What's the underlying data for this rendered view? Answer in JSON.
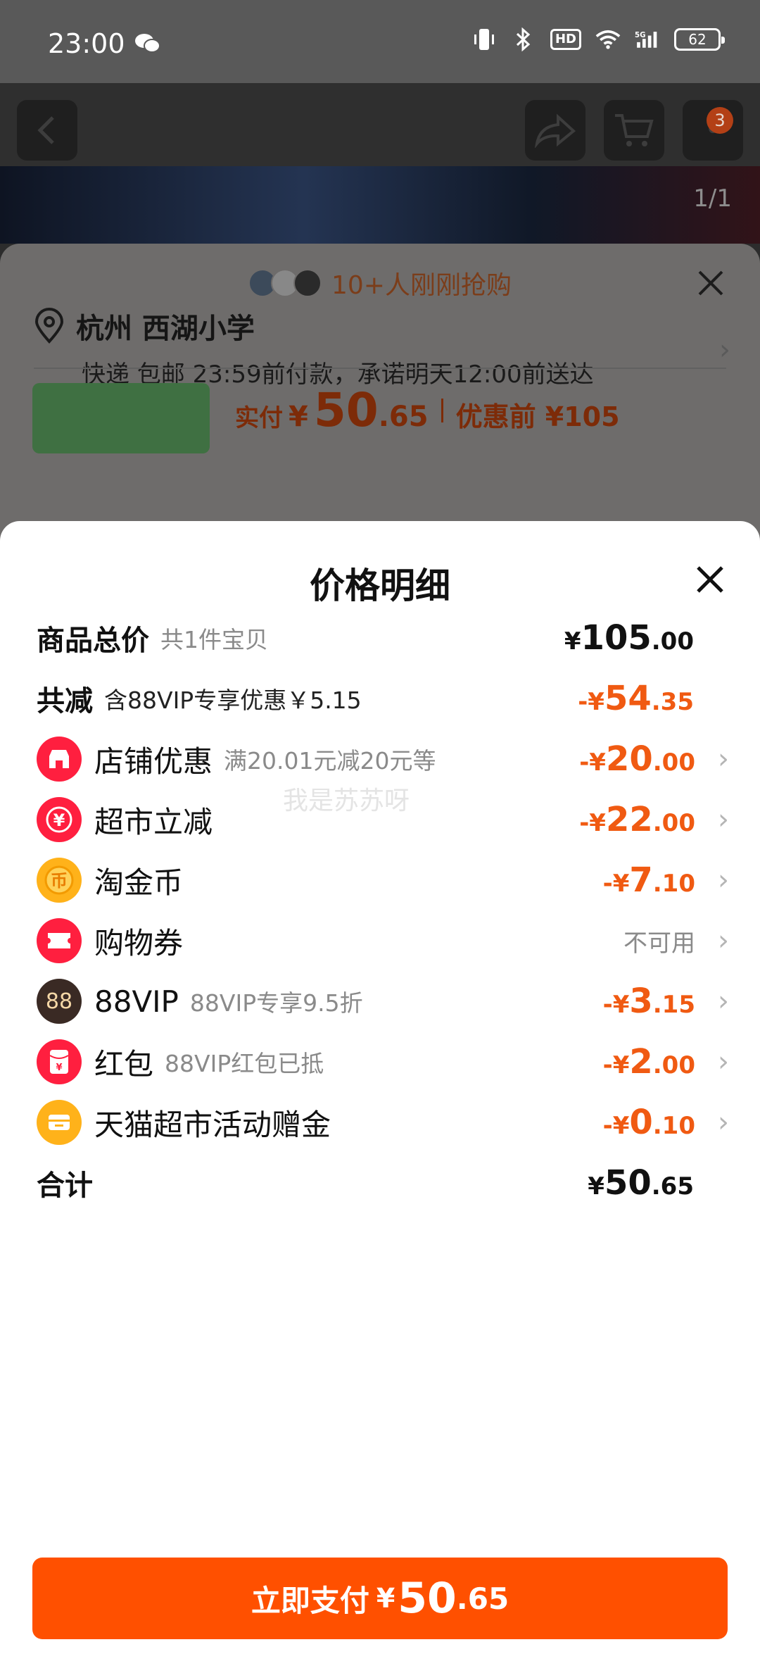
{
  "status_bar": {
    "time": "23:00",
    "battery": "62"
  },
  "background_page": {
    "cart_badge": "3",
    "image_counter": "1/1",
    "buyers_text": "10+人刚刚抢购",
    "address": {
      "location": "杭州 西湖小学",
      "delivery": "快递 包邮 23:59前付款，承诺明天12:00前送达"
    },
    "price": {
      "label": "实付",
      "yen": "¥",
      "int": "50",
      "dec": ".65",
      "before": "优惠前 ¥105"
    }
  },
  "sheet": {
    "title": "价格明细",
    "total_row": {
      "label": "商品总价",
      "sub": "共1件宝贝",
      "yen": "¥",
      "int": "105",
      "dec": ".00"
    },
    "reduce_row": {
      "label": "共减",
      "sub": "含88VIP专享优惠￥5.15",
      "prefix": "-¥",
      "int": "54",
      "dec": ".35"
    },
    "items": [
      {
        "label": "店铺优惠",
        "sub": "满20.01元减20元等",
        "prefix": "-¥",
        "int": "20",
        "dec": ".00",
        "icon": "shop-icon",
        "color": "#ff1f3f"
      },
      {
        "label": "超市立减",
        "sub": "",
        "prefix": "-¥",
        "int": "22",
        "dec": ".00",
        "icon": "yuan-icon",
        "color": "#ff1f3f"
      },
      {
        "label": "淘金币",
        "sub": "",
        "prefix": "-¥",
        "int": "7",
        "dec": ".10",
        "icon": "coin-icon",
        "color": "#ffb21a"
      },
      {
        "label": "购物券",
        "sub": "",
        "status": "不可用",
        "icon": "ticket-icon",
        "color": "#ff1f3f"
      },
      {
        "label": "88VIP",
        "sub": "88VIP专享9.5折",
        "prefix": "-¥",
        "int": "3",
        "dec": ".15",
        "icon": "vip-icon",
        "icon_text": "88",
        "color": "#3a2a24"
      },
      {
        "label": "红包",
        "sub": "88VIP红包已抵",
        "prefix": "-¥",
        "int": "2",
        "dec": ".00",
        "icon": "red-envelope-icon",
        "color": "#ff1f3f"
      },
      {
        "label": "天猫超市活动赠金",
        "sub": "",
        "prefix": "-¥",
        "int": "0",
        "dec": ".10",
        "icon": "gift-card-icon",
        "color": "#ffb21a"
      }
    ],
    "sum_row": {
      "label": "合计",
      "yen": "¥",
      "int": "50",
      "dec": ".65"
    },
    "pay_button": {
      "label": "立即支付",
      "yen": "¥",
      "int": "50",
      "dec": ".65"
    },
    "watermark": "我是苏苏呀"
  },
  "colors": {
    "accent": "#ff5000",
    "discount": "#f05a12"
  }
}
